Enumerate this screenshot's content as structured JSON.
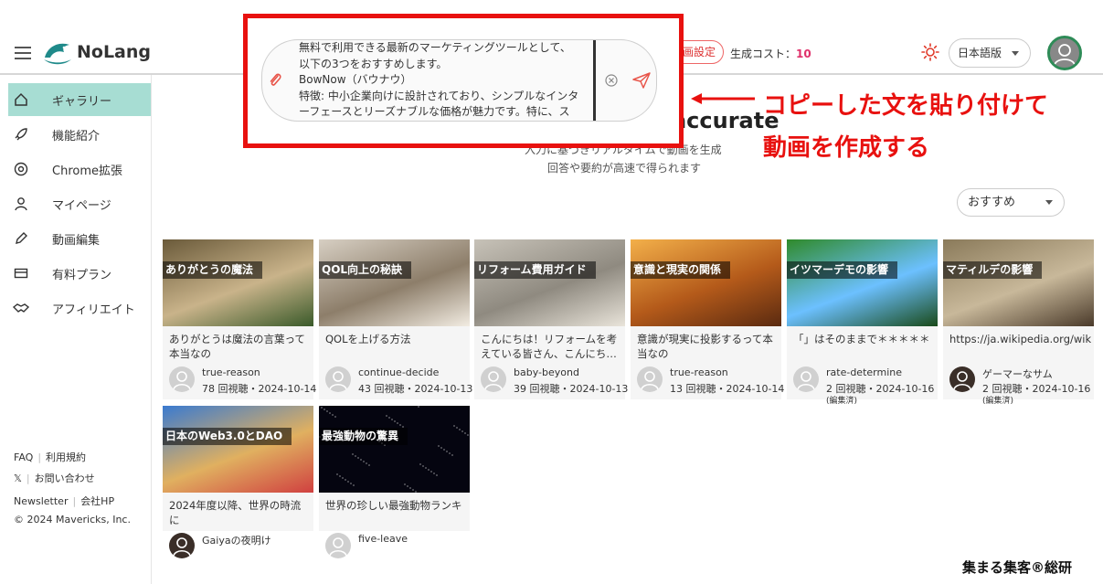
{
  "header": {
    "logo_text": "NoLang",
    "video_settings_label": "動画設定",
    "cost_label": "生成コスト：",
    "cost_value": "10",
    "language": "日本語版"
  },
  "prompt": {
    "lines": [
      "無料で利用できる最新のマーケティングツールとして、",
      "以下の3つをおすすめします。",
      "BowNow（バウナウ）",
      "特徴: 中小企業向けに設計されており、シンプルなインタ",
      "ーフェースとリーズナブルな価格が魅力です。特に、ス"
    ]
  },
  "sidebar": {
    "items": [
      {
        "label": "ギャラリー",
        "icon": "home-icon"
      },
      {
        "label": "機能紹介",
        "icon": "rocket-icon"
      },
      {
        "label": "Chrome拡張",
        "icon": "chrome-icon"
      },
      {
        "label": "マイページ",
        "icon": "user-icon"
      },
      {
        "label": "動画編集",
        "icon": "pencil-icon"
      },
      {
        "label": "有料プラン",
        "icon": "card-icon"
      },
      {
        "label": "アフィリエイト",
        "icon": "handshake-icon"
      }
    ],
    "footer": {
      "faq": "FAQ",
      "terms": "利用規約",
      "x": "𝕏",
      "contact": "お問い合わせ",
      "newsletter": "Newsletter",
      "company": "会社HP",
      "copyright": "© 2024 Mavericks, Inc."
    }
  },
  "main": {
    "hero_title": "Faster, more accurate",
    "hero_sub1": "入力に基づきリアルタイムで動画を生成",
    "hero_sub2": "回答や要約が高速で得られます",
    "sort": "おすすめ"
  },
  "cards": [
    {
      "title": "ありがとうの魔法",
      "desc": "ありがとうは魔法の言葉って本当なの",
      "user": "true-reason",
      "meta": "78 回視聴・2024-10-14",
      "edited": "",
      "bg": [
        "#6a5a3a",
        "#c9b38a",
        "#3a5a2a"
      ]
    },
    {
      "title": "QOL向上の秘訣",
      "desc": "QOLを上げる方法",
      "user": "continue-decide",
      "meta": "43 回視聴・2024-10-13",
      "edited": "",
      "bg": [
        "#d7cfc3",
        "#8d7e6a",
        "#f2ece2"
      ]
    },
    {
      "title": "リフォーム費用ガイド",
      "desc": "こんにちは！リフォームを考えている皆さん、こんにち…",
      "user": "baby-beyond",
      "meta": "39 回視聴・2024-10-13",
      "edited": "",
      "bg": [
        "#c7c2b8",
        "#8f8a80",
        "#e9e4da"
      ]
    },
    {
      "title": "意識と現実の関係",
      "desc": "意識が現実に投影するって本当なの",
      "user": "true-reason",
      "meta": "13 回視聴・2024-10-14",
      "edited": "",
      "bg": [
        "#f3b04a",
        "#b45a1a",
        "#5a2a10"
      ]
    },
    {
      "title": "イツマーデモの影響",
      "desc": "「」はそのままで＊＊＊＊＊",
      "user": "rate-determine",
      "meta": "2 回視聴・2024-10-16",
      "edited": "(編集済)",
      "bg": [
        "#2f8a2a",
        "#6cc0ff",
        "#1a4a1a"
      ]
    },
    {
      "title": "マティルデの影響",
      "desc": "https://ja.wikipedia.org/wiki/%",
      "user": "ゲーマーなサム",
      "meta": "2 回視聴・2024-10-16",
      "edited": "(編集済)",
      "bg": [
        "#8a7a5a",
        "#c8b89a",
        "#4a3a2a"
      ]
    },
    {
      "title": "日本のWeb3.0とDAO",
      "desc": "2024年度以降、世界の時流に",
      "user": "Gaiyaの夜明け",
      "meta": "",
      "edited": "",
      "bg": [
        "#3a7ad0",
        "#e0b060",
        "#d04040"
      ]
    },
    {
      "title": "最強動物の驚異",
      "desc": "世界の珍しい最強動物ランキ",
      "user": "five-leave",
      "meta": "",
      "edited": "",
      "bg": [
        "#050510",
        "#10121a",
        "#000000"
      ]
    }
  ],
  "annotation": {
    "line1": "コピーした文を貼り付けて",
    "line2": "動画を作成する"
  },
  "credit": "集まる集客®総研",
  "colors": {
    "accent_red": "#e8110f",
    "sidebar_active": "#a7ddd3",
    "logo_teal": "#1f8a8a",
    "cost_pink": "#e0306a"
  }
}
